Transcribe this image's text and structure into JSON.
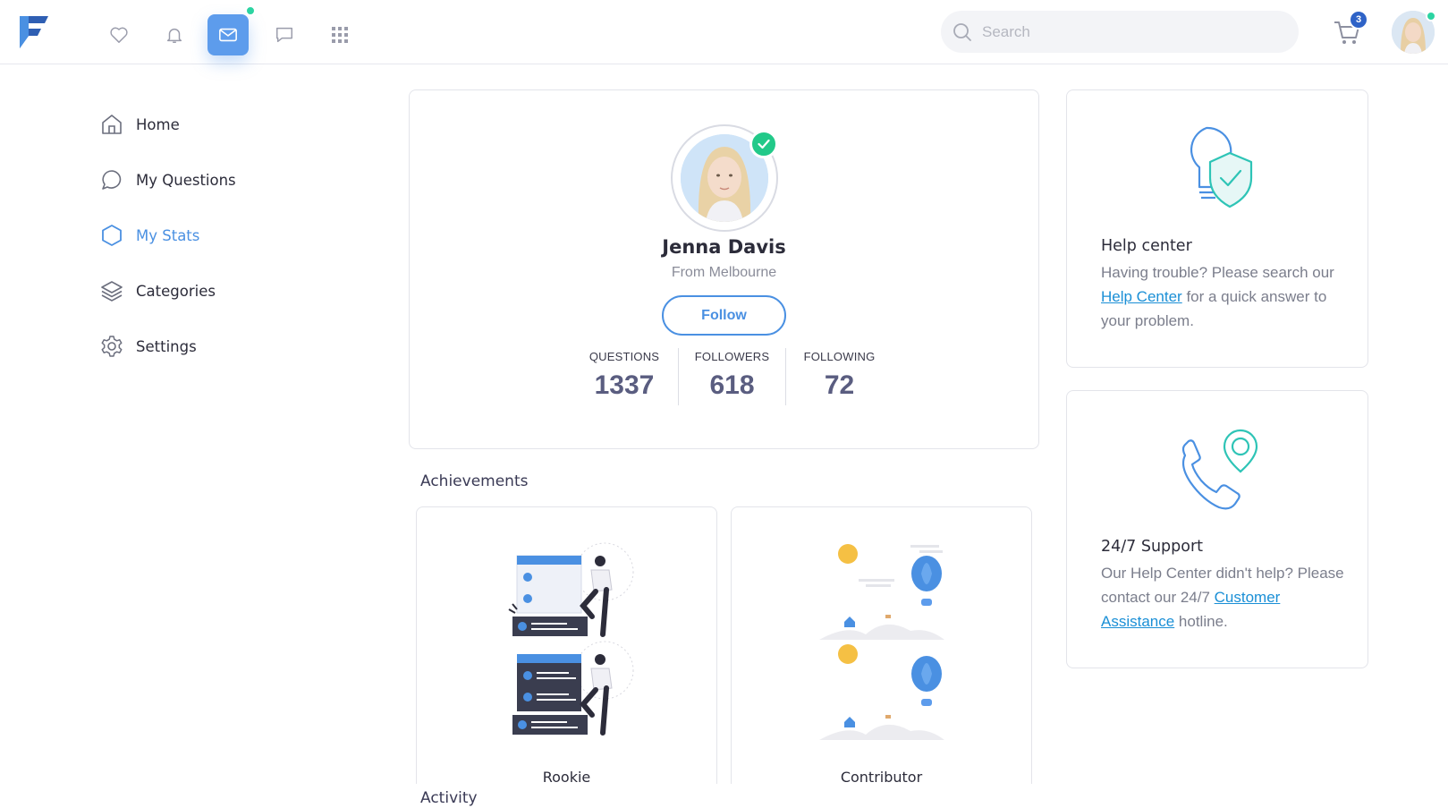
{
  "header": {
    "logo": "F",
    "nav_icons": [
      "heart-icon",
      "bell-icon",
      "mail-icon",
      "chat-icon",
      "grid-icon"
    ],
    "search_placeholder": "Search",
    "cart_count": "3",
    "accent": "#5d9cec"
  },
  "sidebar": {
    "items": [
      {
        "label": "Home",
        "icon": "home-icon"
      },
      {
        "label": "My Questions",
        "icon": "chat-bubble-icon"
      },
      {
        "label": "My Stats",
        "icon": "hexagon-icon",
        "active": true
      },
      {
        "label": "Categories",
        "icon": "layers-icon"
      },
      {
        "label": "Settings",
        "icon": "gear-icon"
      }
    ]
  },
  "profile": {
    "name": "Jenna Davis",
    "location": "From Melbourne",
    "follow_label": "Follow",
    "stats": [
      {
        "label": "QUESTIONS",
        "value": "1337"
      },
      {
        "label": "FOLLOWERS",
        "value": "618"
      },
      {
        "label": "FOLLOWING",
        "value": "72"
      }
    ]
  },
  "achievements": {
    "title": "Achievements",
    "items": [
      {
        "label": "Rookie"
      },
      {
        "label": "Contributor"
      }
    ]
  },
  "activity": {
    "title": "Activity"
  },
  "help_center": {
    "title": "Help center",
    "text_before": "Having trouble? Please search our ",
    "link": "Help Center",
    "text_after": " for a quick answer to your problem."
  },
  "support": {
    "title": "24/7 Support",
    "text_before": "Our Help Center didn't help? Please contact our 24/7 ",
    "link": "Customer Assistance",
    "text_after": " hotline."
  }
}
